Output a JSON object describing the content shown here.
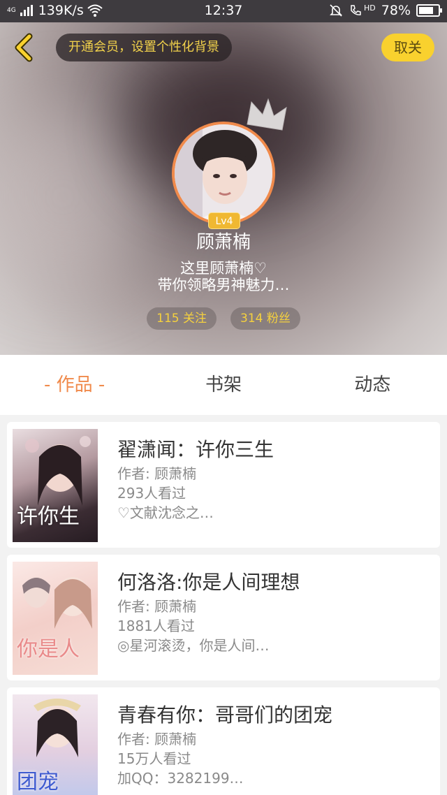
{
  "status_bar": {
    "network_type": "4G",
    "speed": "139K/s",
    "time": "12:37",
    "hd_label": "HD",
    "battery": "78%",
    "battery_level": 0.78
  },
  "header": {
    "vip_banner": "开通会员，设置个性化背景",
    "unfollow_label": "取关",
    "level": "Lv4",
    "username": "顾萧楠",
    "bio_line1": "这里顾萧楠♡",
    "bio_line2": "带你领略男神魅力…",
    "following": "115 关注",
    "followers": "314 粉丝",
    "accent_color": "#f08a4b",
    "highlight_color": "#f9d12e"
  },
  "tabs": [
    {
      "label": "- 作品 -",
      "active": true
    },
    {
      "label": "书架",
      "active": false
    },
    {
      "label": "动态",
      "active": false
    }
  ],
  "books": [
    {
      "title": "翟潇闻：许你三生",
      "author": "作者: 顾萧楠",
      "views": "293人看过",
      "desc": "♡文献沈念之…",
      "cover_text": "许你生"
    },
    {
      "title": "何洛洛:你是人间理想",
      "author": "作者: 顾萧楠",
      "views": "1881人看过",
      "desc": "◎星河滚烫，你是人间…",
      "cover_text": "你是人"
    },
    {
      "title": "青春有你：哥哥们的团宠",
      "author": "作者: 顾萧楠",
      "views": "15万人看过",
      "desc": "加QQ：3282199…",
      "cover_text": "团宠"
    }
  ]
}
